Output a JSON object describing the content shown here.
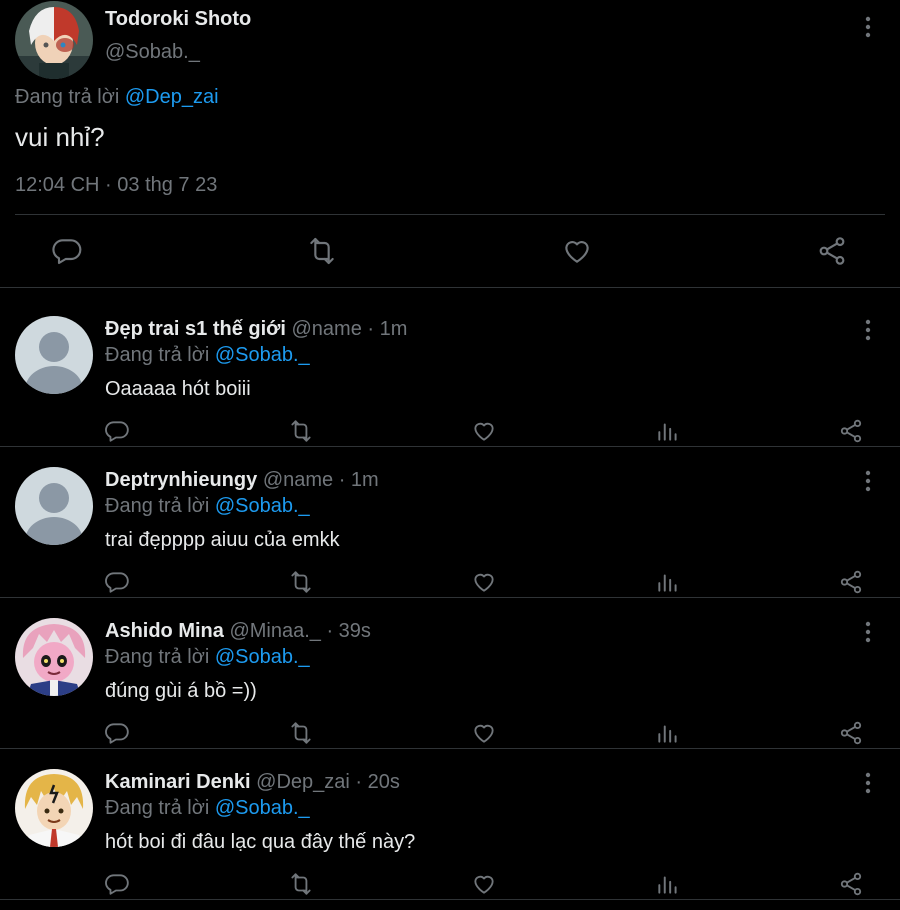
{
  "main_tweet": {
    "name": "Todoroki Shoto",
    "handle": "@Sobab._",
    "replying_prefix": "Đang trả lời",
    "replying_to": "@Dep_zai",
    "text": "vui nhỉ?",
    "timestamp": "12:04 CH · 03 thg 7 23",
    "actions": [
      "reply-icon",
      "retweet-icon",
      "like-icon",
      "share-icon"
    ]
  },
  "replies": [
    {
      "name": "Đẹp trai s1 thế giới",
      "meta": "@name · 1m",
      "replying_prefix": "Đang trả lời",
      "replying_to": "@Sobab._",
      "text": "Oaaaaa hót boiii",
      "avatar": "default-avatar"
    },
    {
      "name": "Deptrynhieungy",
      "meta": "@name · 1m",
      "replying_prefix": "Đang trả lời",
      "replying_to": "@Sobab._",
      "text": "trai đẹpppp aiuu của emkk",
      "avatar": "default-avatar"
    },
    {
      "name": "Ashido Mina",
      "meta": "@Minaa._ · 39s",
      "replying_prefix": "Đang trả lời",
      "replying_to": "@Sobab._",
      "text": "đúng gùi á bồ =))",
      "avatar": "anime-avatar-pink"
    },
    {
      "name": "Kaminari Denki",
      "meta": "@Dep_zai · 20s",
      "replying_prefix": "Đang trả lời",
      "replying_to": "@Sobab._",
      "text": "hót boi đi đâu lạc qua đây thế này?",
      "avatar": "anime-avatar-blonde"
    }
  ],
  "colors": {
    "background": "#000000",
    "text": "#e7e9ea",
    "muted": "#71767b",
    "link": "#1d9bf0",
    "divider": "#2f3336"
  }
}
